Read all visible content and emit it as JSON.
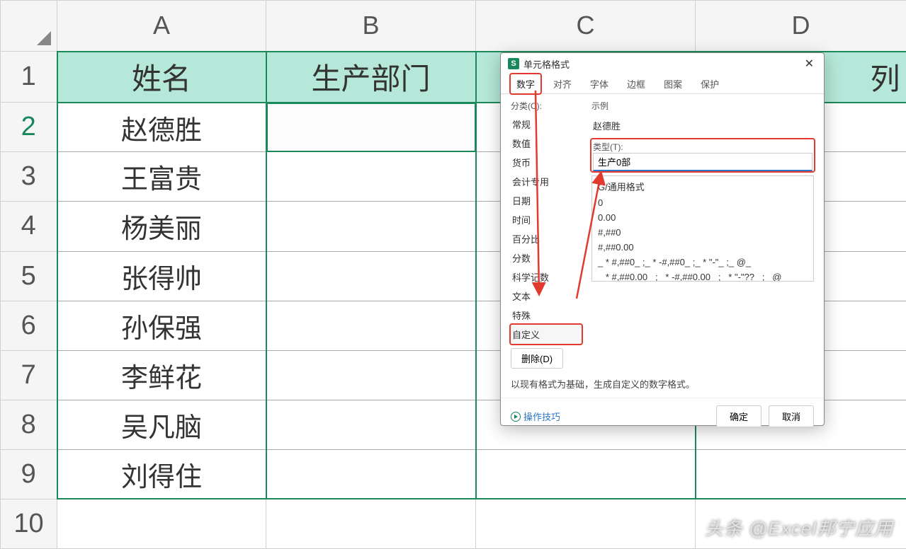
{
  "columns": [
    "A",
    "B",
    "C",
    "D"
  ],
  "row_numbers": [
    1,
    2,
    3,
    4,
    5,
    6,
    7,
    8,
    9,
    10
  ],
  "headers": {
    "A": "姓名",
    "B": "生产部门",
    "C": "",
    "D": ""
  },
  "partial_header_D_hint": "列",
  "rows": [
    {
      "A": "赵德胜",
      "B": ""
    },
    {
      "A": "王富贵",
      "B": ""
    },
    {
      "A": "杨美丽",
      "B": ""
    },
    {
      "A": "张得帅",
      "B": ""
    },
    {
      "A": "孙保强",
      "B": ""
    },
    {
      "A": "李鲜花",
      "B": ""
    },
    {
      "A": "吴凡脑",
      "B": ""
    },
    {
      "A": "刘得住",
      "B": ""
    }
  ],
  "selected_cell": "B2",
  "dialog": {
    "title": "单元格格式",
    "icon_letter": "S",
    "tabs": [
      "数字",
      "对齐",
      "字体",
      "边框",
      "图案",
      "保护"
    ],
    "active_tab_index": 0,
    "category_label": "分类(C):",
    "categories": [
      "常规",
      "数值",
      "货币",
      "会计专用",
      "日期",
      "时间",
      "百分比",
      "分数",
      "科学记数",
      "文本",
      "特殊",
      "自定义"
    ],
    "selected_category_index": 11,
    "sample_label": "示例",
    "sample_value": "赵德胜",
    "type_label": "类型(T):",
    "type_value": "生产0部",
    "format_list": [
      "G/通用格式",
      "0",
      "0.00",
      "#,##0",
      "#,##0.00",
      "_ * #,##0_ ;_ * -#,##0_ ;_ * \"-\"_ ;_ @_ ",
      "_ * #,##0.00_ ;_ * -#,##0.00_ ;_ * \"-\"??_ ;_ @_ "
    ],
    "delete_label": "删除(D)",
    "hint": "以现有格式为基础，生成自定义的数字格式。",
    "tips_label": "操作技巧",
    "ok_label": "确定",
    "cancel_label": "取消"
  },
  "watermark": "头条 @Excel邦宁应用"
}
